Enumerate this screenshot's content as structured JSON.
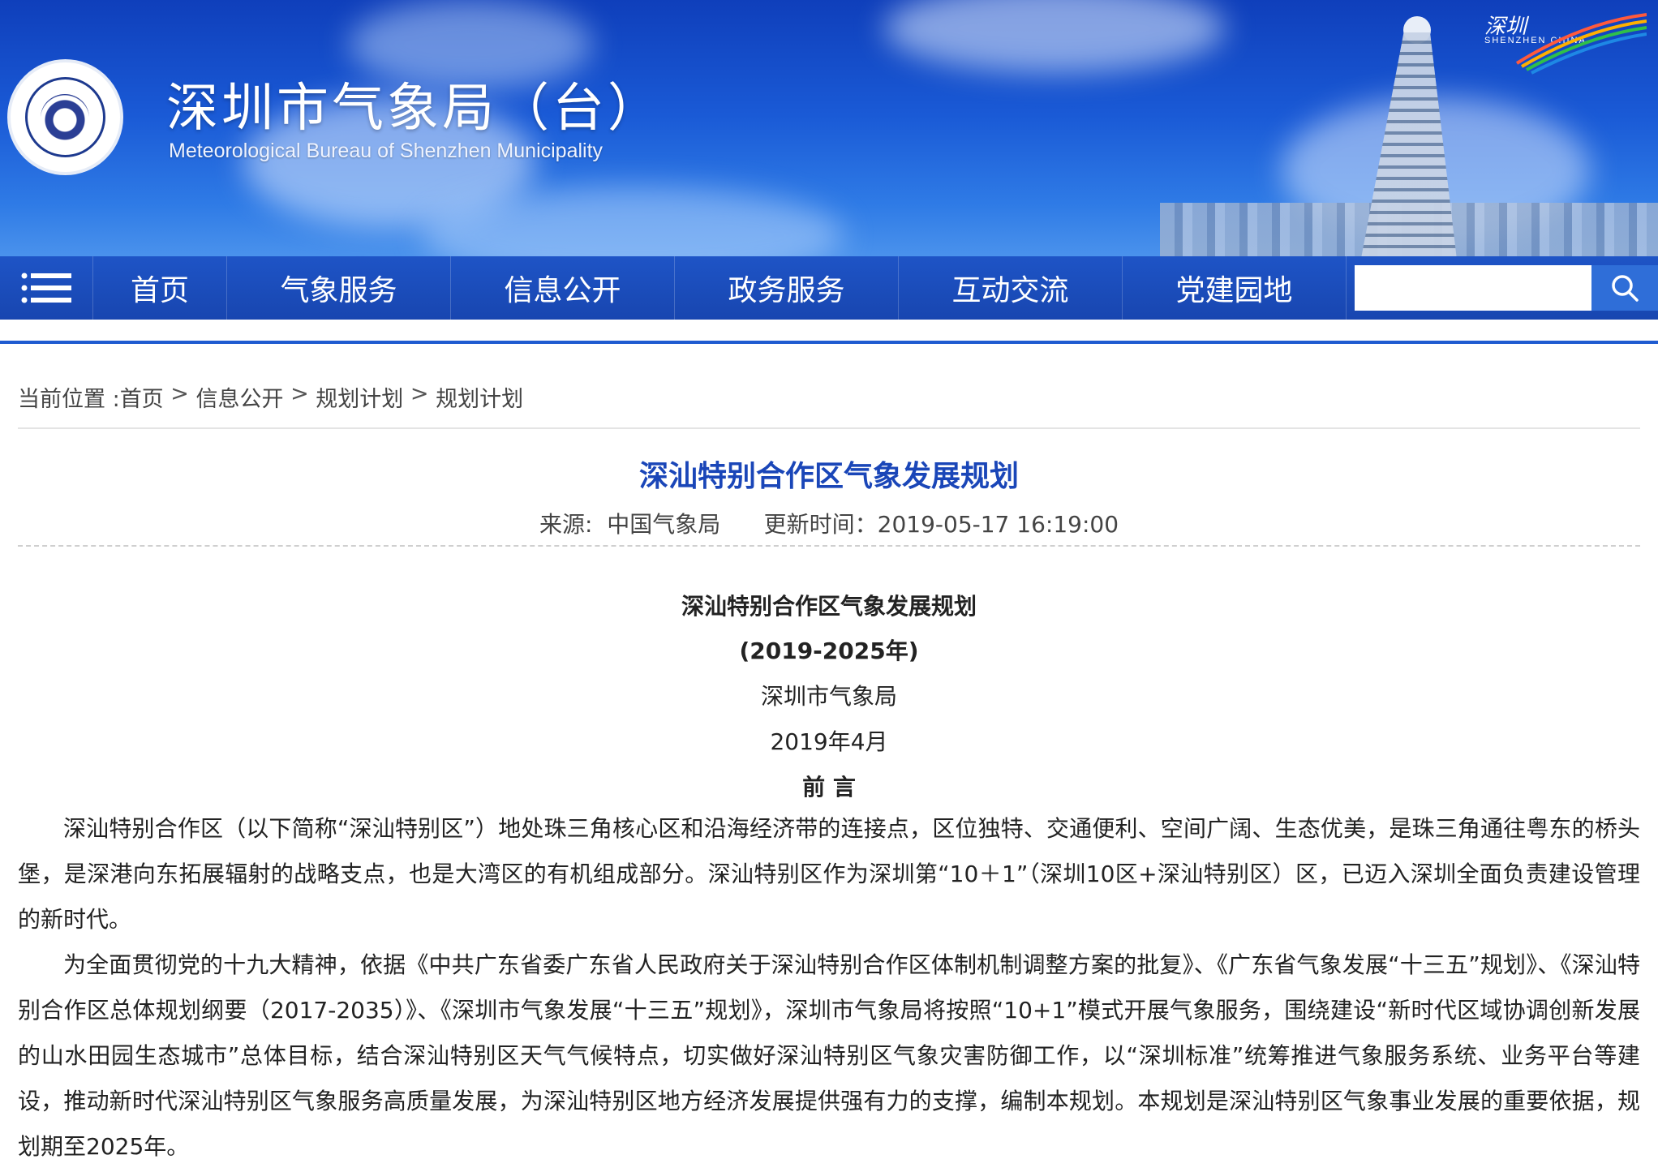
{
  "header": {
    "title": "深圳市气象局（台）",
    "subtitle": "Meteorological Bureau of Shenzhen Municipality",
    "city_logo_text": "深圳",
    "city_logo_sub": "SHENZHEN CHINA",
    "accent_color": "#1a4fc4"
  },
  "nav": {
    "items": [
      {
        "label": "首页"
      },
      {
        "label": "气象服务"
      },
      {
        "label": "信息公开"
      },
      {
        "label": "政务服务"
      },
      {
        "label": "互动交流"
      },
      {
        "label": "党建园地"
      }
    ],
    "search_placeholder": "",
    "menu_icon": "hamburger-icon",
    "search_icon": "search-icon"
  },
  "breadcrumb": {
    "prefix": "当前位置 :",
    "items": [
      "首页",
      "信息公开",
      "规划计划",
      "规划计划"
    ],
    "separator": " > "
  },
  "article": {
    "title": "深汕特别合作区气象发展规划",
    "source_label": "来源:  ",
    "source": "中国气象局",
    "updated_label": "更新时间：",
    "updated": "2019-05-17 16:19:00",
    "doc_title": "深汕特别合作区气象发展规划",
    "doc_period": "(2019-2025年)",
    "doc_org": "深圳市气象局",
    "doc_date": "2019年4月",
    "section_title": "前 言",
    "paragraphs": [
      "深汕特别合作区（以下简称“深汕特别区”）地处珠三角核心区和沿海经济带的连接点，区位独特、交通便利、空间广阔、生态优美，是珠三角通往粤东的桥头堡，是深港向东拓展辐射的战略支点，也是大湾区的有机组成部分。深汕特别区作为深圳第“10＋1”（深圳10区+深汕特别区）区，已迈入深圳全面负责建设管理的新时代。",
      "为全面贯彻党的十九大精神，依据《中共广东省委广东省人民政府关于深汕特别合作区体制机制调整方案的批复》、《广东省气象发展“十三五”规划》、《深汕特别合作区总体规划纲要（2017-2035）》、《深圳市气象发展“十三五”规划》，深圳市气象局将按照“10+1”模式开展气象服务，围绕建设“新时代区域协调创新发展的山水田园生态城市”总体目标，结合深汕特别区天气气候特点，切实做好深汕特别区气象灾害防御工作，以“深圳标准”统筹推进气象服务系统、业务平台等建设，推动新时代深汕特别区气象服务高质量发展，为深汕特别区地方经济发展提供强有力的支撑，编制本规划。本规划是深汕特别区气象事业发展的重要依据，规划期至2025年。"
    ]
  }
}
